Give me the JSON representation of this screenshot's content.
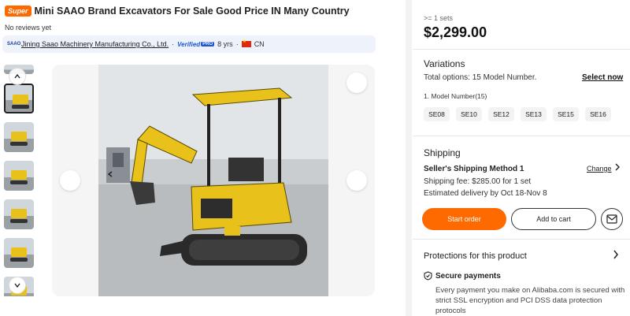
{
  "product": {
    "badge": "Super",
    "title": "Mini SAAO Brand Excavators For Sale Good Price IN Many Country",
    "reviews": "No reviews yet"
  },
  "supplier": {
    "logo_text": "SAAO",
    "name": "Jining Saao Machinery Manufacturing Co., Ltd.",
    "separator": "·",
    "verified_label": "Verified",
    "verified_badge": "PRO",
    "years": "8 yrs",
    "country": "CN"
  },
  "gallery": {
    "thumbnail_count": 7,
    "active_index": 1
  },
  "pricing": {
    "moq": ">= 1 sets",
    "price": "$2,299.00"
  },
  "variations": {
    "title": "Variations",
    "total": "Total options: 15 Model Number.",
    "select_now": "Select now",
    "model_label": "1. Model Number(15)",
    "options": [
      "SE08",
      "SE10",
      "SE12",
      "SE13",
      "SE15",
      "SE16"
    ]
  },
  "shipping": {
    "title": "Shipping",
    "method": "Seller's Shipping Method 1",
    "change": "Change",
    "fee": "Shipping fee: $285.00 for 1 set",
    "delivery": "Estimated delivery by Oct 18-Nov 8"
  },
  "actions": {
    "start_order": "Start order",
    "add_to_cart": "Add to cart"
  },
  "protections": {
    "title": "Protections for this product",
    "secure_title": "Secure payments",
    "secure_desc": "Every payment you make on Alibaba.com is secured with strict SSL encryption and PCI DSS data protection protocols"
  },
  "colors": {
    "accent": "#ff6a00",
    "verified_blue": "#1a56d6",
    "excavator_yellow": "#e8c11a"
  }
}
